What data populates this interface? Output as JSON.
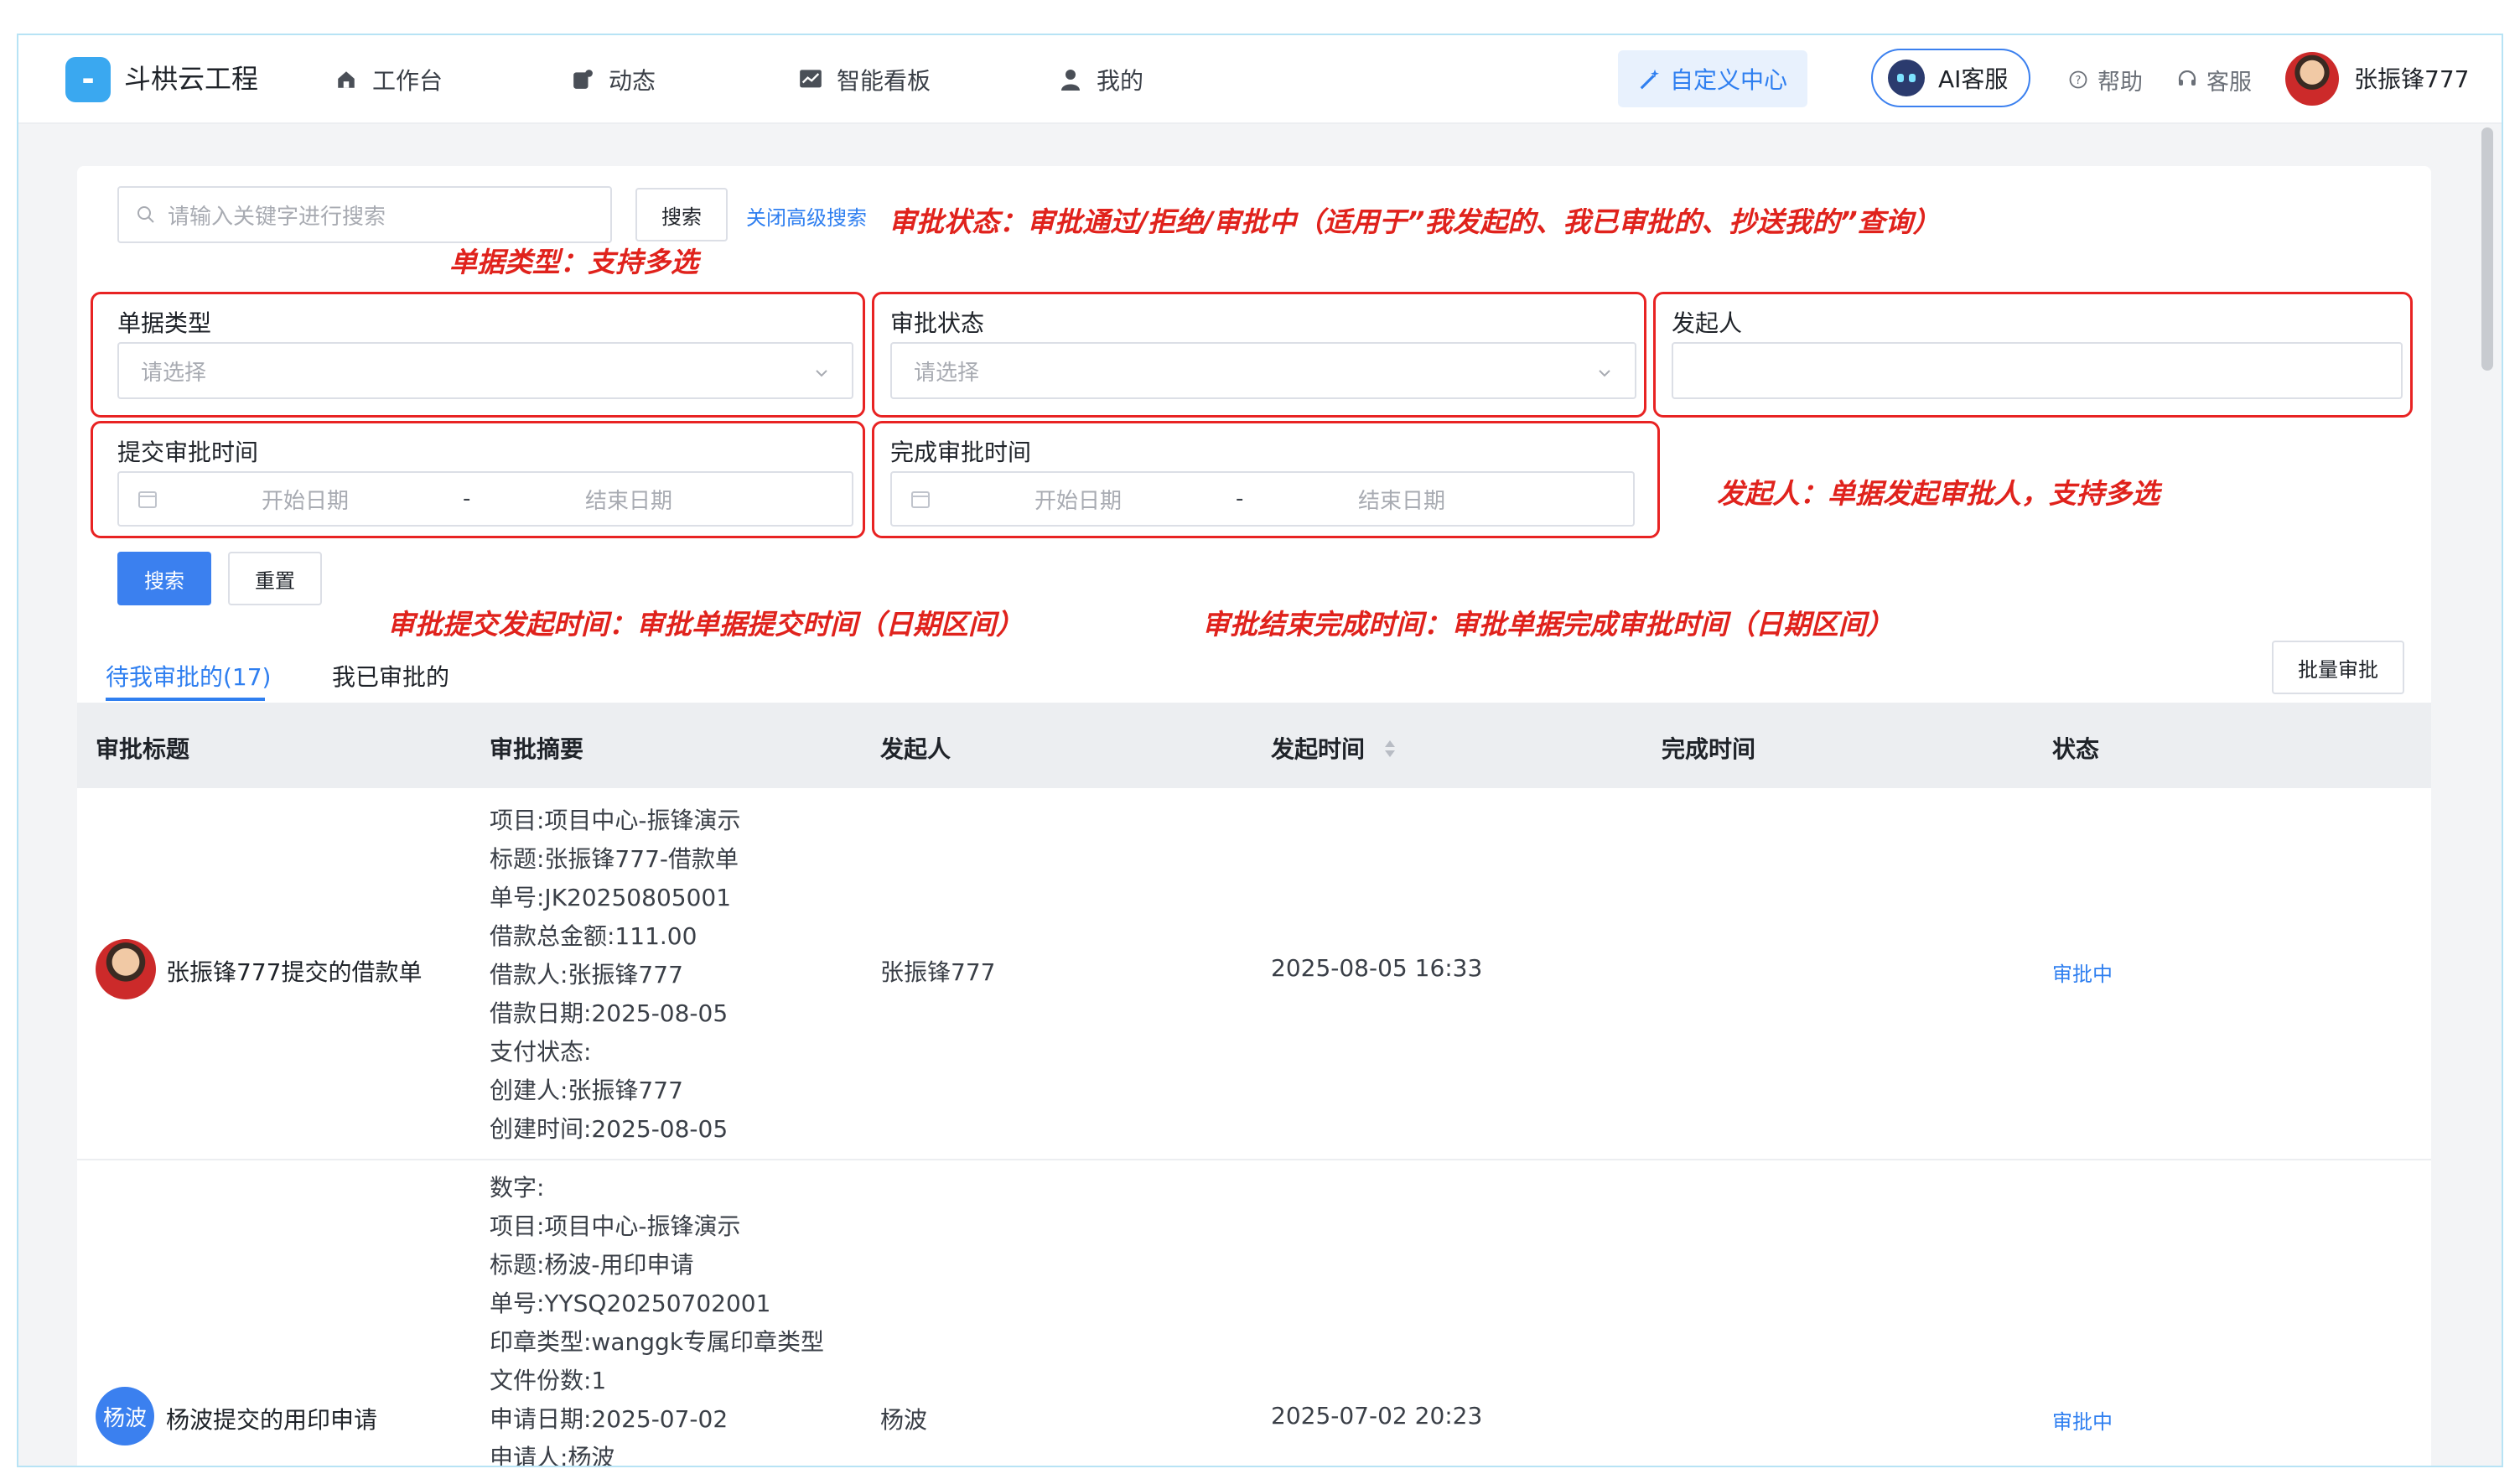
{
  "header": {
    "brand": "斗栱云工程",
    "nav": [
      {
        "label": "工作台",
        "icon": "home-icon"
      },
      {
        "label": "动态",
        "icon": "activity-icon"
      },
      {
        "label": "智能看板",
        "icon": "dashboard-icon"
      },
      {
        "label": "我的",
        "icon": "user-icon"
      }
    ],
    "custom_center": "自定义中心",
    "ai_service": "AI客服",
    "help": "帮助",
    "service": "客服",
    "username": "张振锋777"
  },
  "search": {
    "placeholder": "请输入关键字进行搜索",
    "search_button": "搜索",
    "advanced_toggle": "关闭高级搜索"
  },
  "annotations": {
    "status": "审批状态：审批通过/拒绝/审批中（适用于”我发起的、我已审批的、抄送我的”查询）",
    "doc_type": "单据类型：支持多选",
    "initiator": "发起人：单据发起审批人，支持多选",
    "submit_time": "审批提交发起时间：审批单据提交时间（日期区间）",
    "finish_time": "审批结束完成时间：审批单据完成审批时间（日期区间）"
  },
  "filters": {
    "doc_type": {
      "label": "单据类型",
      "placeholder": "请选择"
    },
    "status": {
      "label": "审批状态",
      "placeholder": "请选择"
    },
    "initiator": {
      "label": "发起人",
      "value": ""
    },
    "submit_time": {
      "label": "提交审批时间",
      "start": "开始日期",
      "sep": "-",
      "end": "结束日期"
    },
    "finish_time": {
      "label": "完成审批时间",
      "start": "开始日期",
      "sep": "-",
      "end": "结束日期"
    },
    "search_button": "搜索",
    "reset_button": "重置"
  },
  "tabs": [
    {
      "label": "待我审批的(17)",
      "active": true
    },
    {
      "label": "我已审批的",
      "active": false
    }
  ],
  "batch_button": "批量审批",
  "table": {
    "columns": [
      "审批标题",
      "审批摘要",
      "发起人",
      "发起时间",
      "完成时间",
      "状态"
    ],
    "rows": [
      {
        "title": "张振锋777提交的借款单",
        "avatar_text": "",
        "summary": [
          "项目:项目中心-振锋演示",
          "标题:张振锋777-借款单",
          "单号:JK20250805001",
          "借款总金额:111.00",
          "借款人:张振锋777",
          "借款日期:2025-08-05",
          "支付状态:",
          "创建人:张振锋777",
          "创建时间:2025-08-05"
        ],
        "initiator": "张振锋777",
        "start_time": "2025-08-05 16:33",
        "finish_time": "",
        "status": "审批中"
      },
      {
        "title": "杨波提交的用印申请",
        "avatar_text": "杨波",
        "summary": [
          "数字:",
          "项目:项目中心-振锋演示",
          "标题:杨波-用印申请",
          "单号:YYSQ20250702001",
          "印章类型:wanggk专属印章类型",
          "文件份数:1",
          "申请日期:2025-07-02",
          "申请人:杨波"
        ],
        "initiator": "杨波",
        "start_time": "2025-07-02 20:23",
        "finish_time": "",
        "status": "审批中"
      }
    ]
  },
  "colors": {
    "primary": "#3b80ef",
    "annotation_red": "#e0221c",
    "annotation_blue": "#2b6fe0",
    "header_row_bg": "#eceef1"
  }
}
